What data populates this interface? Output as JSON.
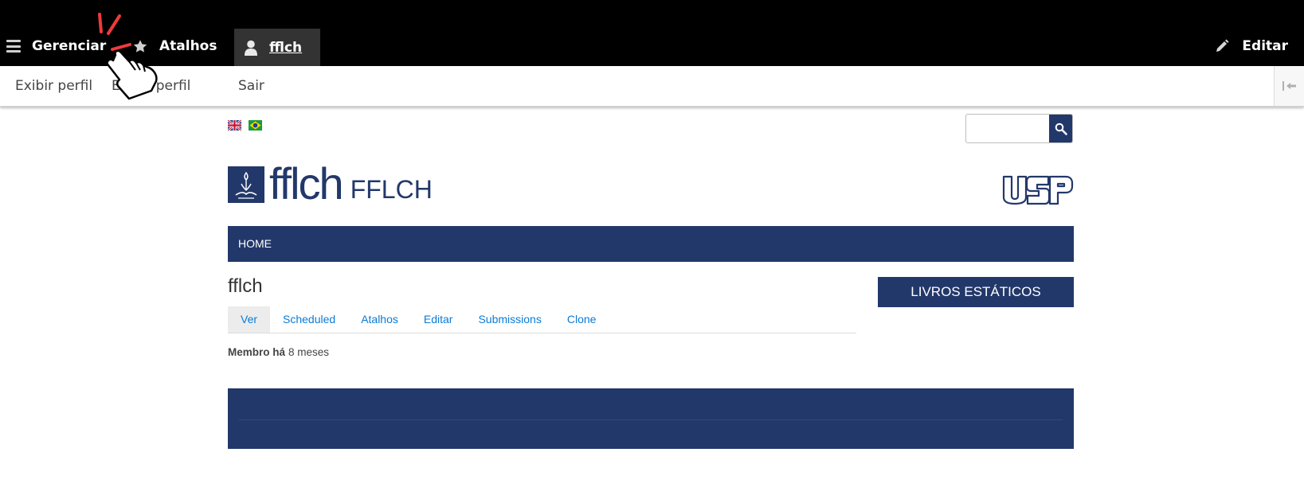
{
  "toolbar": {
    "manage_label": "Gerenciar",
    "shortcuts_label": "Atalhos",
    "user_label": "fflch",
    "edit_label": "Editar"
  },
  "tray": {
    "view_profile": "Exibir perfil",
    "edit_profile": "Editar perfil",
    "logout": "Sair"
  },
  "header": {
    "logo_word": "fflch",
    "logo_name": "FFLCH",
    "languages": [
      "English",
      "Português"
    ]
  },
  "nav": {
    "home": "HOME"
  },
  "page": {
    "title": "fflch",
    "tabs": [
      "Ver",
      "Scheduled",
      "Atalhos",
      "Editar",
      "Submissions",
      "Clone"
    ],
    "active_tab": "Ver",
    "member_label": "Membro há",
    "member_value": "8 meses"
  },
  "sidebar": {
    "button_label": "LIVROS ESTÁTICOS"
  },
  "colors": {
    "brand_navy": "#23386a",
    "toolbar_black": "#000000",
    "link_blue": "#0b7bd6"
  },
  "icons": {
    "manage": "hamburger-icon",
    "shortcuts": "star-icon",
    "user": "user-icon",
    "edit": "pencil-icon",
    "search": "magnifier-icon"
  }
}
